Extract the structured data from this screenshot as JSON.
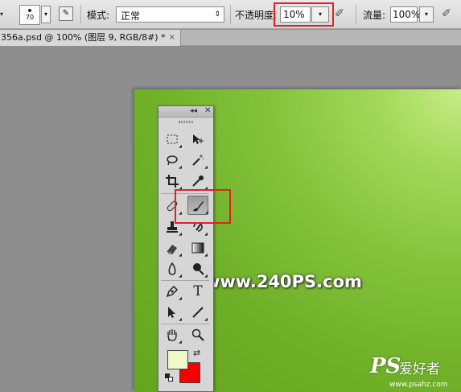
{
  "options_bar": {
    "brush_size": "70",
    "mode_label": "模式:",
    "mode_value": "正常",
    "opacity_label": "不透明度:",
    "opacity_value": "10%",
    "flow_label": "流量:",
    "flow_value": "100%"
  },
  "document_tab": {
    "title": "356a.psd @ 100% (图层 9, RGB/8#) *",
    "close": "×"
  },
  "tools_panel": {
    "collapse": "◂◂",
    "close": "✕",
    "highlighted_tool": "brush-tool",
    "foreground_color": "#eef8c9",
    "background_color": "#f40000",
    "text_tool_glyph": "T"
  },
  "canvas": {
    "watermark": "www.240PS.com",
    "logo_ps": "PS",
    "logo_cn": "爱好者",
    "site": "www.psahz.com"
  },
  "colors": {
    "highlight_red": "#e42020",
    "canvas_green": "#6fb028"
  }
}
